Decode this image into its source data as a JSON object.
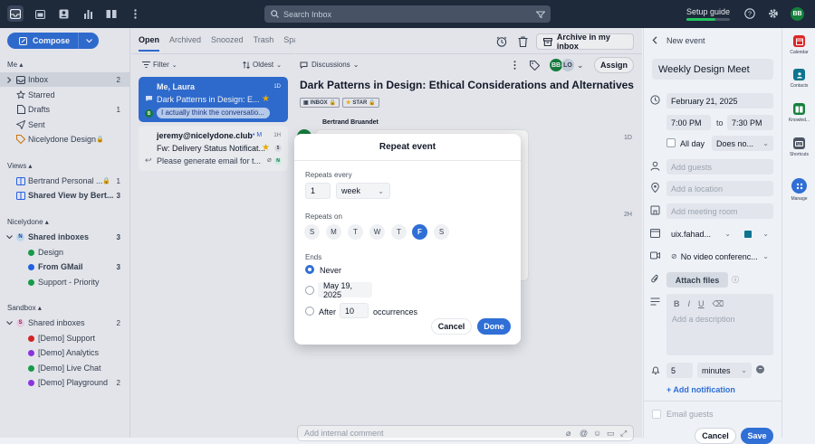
{
  "topbar": {
    "search_placeholder": "Search Inbox",
    "setup_label": "Setup guide",
    "user_initials": "BB"
  },
  "sidebar": {
    "compose_label": "Compose",
    "me_label": "Me",
    "me_items": [
      {
        "label": "Inbox",
        "count": "2",
        "icon": "inbox-icon"
      },
      {
        "label": "Starred",
        "count": "",
        "icon": "star-icon"
      },
      {
        "label": "Drafts",
        "count": "1",
        "icon": "file-icon"
      },
      {
        "label": "Sent",
        "count": "",
        "icon": "send-icon"
      },
      {
        "label": "Nicelydone Design",
        "count": "",
        "icon": "tag-icon"
      }
    ],
    "views_label": "Views",
    "views_items": [
      {
        "label": "Bertrand Personal ...",
        "count": "1"
      },
      {
        "label": "Shared View by Bert...",
        "count": "3"
      }
    ],
    "nicelydone_label": "Nicelydone",
    "nicelydone_group": {
      "label": "Shared inboxes",
      "count": "3",
      "initial": "N"
    },
    "nicelydone_items": [
      {
        "label": "Design",
        "count": "",
        "color": "#16a34a"
      },
      {
        "label": "From GMail",
        "count": "3",
        "color": "#2563eb"
      },
      {
        "label": "Support - Priority",
        "count": "",
        "color": "#16a34a"
      }
    ],
    "sandbox_label": "Sandbox",
    "sandbox_group": {
      "label": "Shared inboxes",
      "count": "2",
      "initial": "S"
    },
    "sandbox_items": [
      {
        "label": "[Demo] Support",
        "count": "",
        "color": "#dc2626"
      },
      {
        "label": "[Demo] Analytics",
        "count": "",
        "color": "#9333ea"
      },
      {
        "label": "[Demo] Live Chat",
        "count": "",
        "color": "#16a34a"
      },
      {
        "label": "[Demo] Playground",
        "count": "2",
        "color": "#9333ea"
      }
    ]
  },
  "list": {
    "tabs": [
      "Open",
      "Archived",
      "Snoozed",
      "Trash",
      "Spam"
    ],
    "filter_label": "Filter",
    "sort_label": "Oldest",
    "cards": [
      {
        "from": "Me, Laura",
        "time": "1D",
        "subject": "Dark Patterns in Design: E...",
        "preview": "I actually think the conversatio..."
      },
      {
        "from": "jeremy@nicelydone.club",
        "time": "1H",
        "subject": "Fw: Delivery Status Notificat...",
        "preview": "Please generate email for t...",
        "count": "5"
      }
    ]
  },
  "main": {
    "discussions_label": "Discussions",
    "assign_label": "Assign",
    "assignees": [
      "BB",
      "LO"
    ],
    "subject": "Dark Patterns in Design: Ethical Considerations and Alternatives",
    "badges": [
      "INBOX",
      "STAR"
    ],
    "sender": "Bertrand Bruandet",
    "time1": "1D",
    "time2": "2H",
    "comment_placeholder": "Add internal comment",
    "archive_label": "Archive in my inbox"
  },
  "modal": {
    "title": "Repeat event",
    "repeats_every_label": "Repeats every",
    "interval": "1",
    "unit": "week",
    "repeats_on_label": "Repeats on",
    "days": [
      "S",
      "M",
      "T",
      "W",
      "T",
      "F",
      "S"
    ],
    "ends_label": "Ends",
    "never_label": "Never",
    "on_date": "May 19, 2025",
    "after_label": "After",
    "occurrences_value": "10",
    "occurrences_label": "occurrences",
    "cancel_label": "Cancel",
    "done_label": "Done"
  },
  "event": {
    "header": "New event",
    "title": "Weekly Design Meet",
    "date": "February 21, 2025",
    "start": "7:00 PM",
    "to_label": "to",
    "end": "7:30 PM",
    "all_day_label": "All day",
    "repeat_value": "Does no...",
    "guests_placeholder": "Add guests",
    "location_placeholder": "Add a location",
    "room_placeholder": "Add meeting room",
    "calendar": "uix.fahad...",
    "video": "No video conferenc...",
    "attach_label": "Attach files",
    "description_placeholder": "Add a description",
    "reminder_value": "5",
    "reminder_unit": "minutes",
    "add_notification": "+ Add notification",
    "email_guests_label": "Email guests",
    "cancel_label": "Cancel",
    "save_label": "Save"
  },
  "rail": {
    "apps": [
      "Calendar",
      "Contacts",
      "Knowled...",
      "Shortcuts",
      "Manage"
    ]
  }
}
